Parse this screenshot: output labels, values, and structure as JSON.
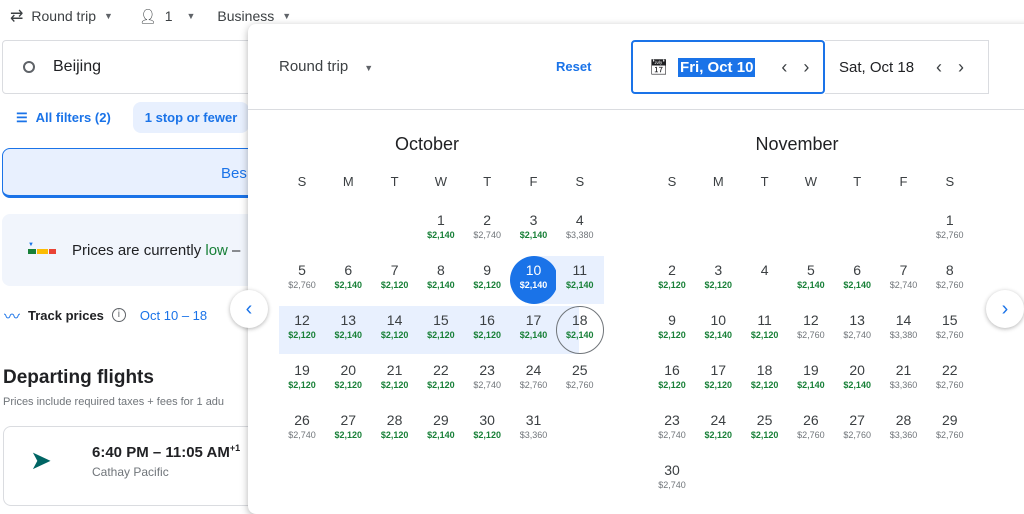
{
  "topbar": {
    "trip_type": "Round trip",
    "passengers": "1",
    "cabin": "Business"
  },
  "search": {
    "origin": "Beijing"
  },
  "filters": {
    "all_filters": "All filters (2)",
    "stops_chip": "1 stop or fewer"
  },
  "tabs": {
    "best": "Bes"
  },
  "insight": {
    "text_before": "Prices are currently ",
    "level": "low",
    "text_after": " –"
  },
  "track": {
    "label": "Track prices",
    "dates": "Oct 10 – 18"
  },
  "departing": {
    "title": "Departing flights",
    "subtitle": "Prices include required taxes + fees for 1 adu"
  },
  "flight": {
    "times": "6:40 PM – 11:05 AM",
    "plus_days": "+1",
    "airline": "Cathay Pacific"
  },
  "picker": {
    "trip_type": "Round trip",
    "reset": "Reset",
    "depart": "Fri, Oct 10",
    "return": "Sat, Oct 18"
  },
  "colors": {
    "accent": "#1a73e8",
    "low_price": "#188038",
    "normal_price": "#70757a"
  },
  "weekdays": [
    "S",
    "M",
    "T",
    "W",
    "T",
    "F",
    "S"
  ],
  "selection": {
    "start": {
      "month": 0,
      "day": 10
    },
    "end": {
      "month": 0,
      "day": 18
    }
  },
  "months": [
    {
      "name": "October",
      "offset": 3,
      "days": [
        [
          "1",
          "$2,140",
          true
        ],
        [
          "2",
          "$2,740",
          false
        ],
        [
          "3",
          "$2,140",
          true
        ],
        [
          "4",
          "$3,380",
          false
        ],
        [
          "5",
          "$2,760",
          false
        ],
        [
          "6",
          "$2,140",
          true
        ],
        [
          "7",
          "$2,120",
          true
        ],
        [
          "8",
          "$2,140",
          true
        ],
        [
          "9",
          "$2,120",
          true
        ],
        [
          "10",
          "$2,140",
          true
        ],
        [
          "11",
          "$2,140",
          true
        ],
        [
          "12",
          "$2,120",
          true
        ],
        [
          "13",
          "$2,140",
          true
        ],
        [
          "14",
          "$2,120",
          true
        ],
        [
          "15",
          "$2,120",
          true
        ],
        [
          "16",
          "$2,120",
          true
        ],
        [
          "17",
          "$2,140",
          true
        ],
        [
          "18",
          "$2,140",
          true
        ],
        [
          "19",
          "$2,120",
          true
        ],
        [
          "20",
          "$2,120",
          true
        ],
        [
          "21",
          "$2,120",
          true
        ],
        [
          "22",
          "$2,120",
          true
        ],
        [
          "23",
          "$2,740",
          false
        ],
        [
          "24",
          "$2,760",
          false
        ],
        [
          "25",
          "$2,760",
          false
        ],
        [
          "26",
          "$2,740",
          false
        ],
        [
          "27",
          "$2,120",
          true
        ],
        [
          "28",
          "$2,120",
          true
        ],
        [
          "29",
          "$2,140",
          true
        ],
        [
          "30",
          "$2,120",
          true
        ],
        [
          "31",
          "$3,360",
          false
        ]
      ]
    },
    {
      "name": "November",
      "offset": 6,
      "days": [
        [
          "1",
          "$2,760",
          false
        ],
        [
          "2",
          "$2,120",
          true
        ],
        [
          "3",
          "$2,120",
          true
        ],
        [
          "4",
          "",
          false
        ],
        [
          "5",
          "$2,140",
          true
        ],
        [
          "6",
          "$2,140",
          true
        ],
        [
          "7",
          "$2,740",
          false
        ],
        [
          "8",
          "$2,760",
          false
        ],
        [
          "9",
          "$2,120",
          true
        ],
        [
          "10",
          "$2,140",
          true
        ],
        [
          "11",
          "$2,120",
          true
        ],
        [
          "12",
          "$2,760",
          false
        ],
        [
          "13",
          "$2,740",
          false
        ],
        [
          "14",
          "$3,380",
          false
        ],
        [
          "15",
          "$2,760",
          false
        ],
        [
          "16",
          "$2,120",
          true
        ],
        [
          "17",
          "$2,120",
          true
        ],
        [
          "18",
          "$2,120",
          true
        ],
        [
          "19",
          "$2,140",
          true
        ],
        [
          "20",
          "$2,140",
          true
        ],
        [
          "21",
          "$3,360",
          false
        ],
        [
          "22",
          "$2,760",
          false
        ],
        [
          "23",
          "$2,740",
          false
        ],
        [
          "24",
          "$2,120",
          true
        ],
        [
          "25",
          "$2,120",
          true
        ],
        [
          "26",
          "$2,760",
          false
        ],
        [
          "27",
          "$2,760",
          false
        ],
        [
          "28",
          "$3,360",
          false
        ],
        [
          "29",
          "$2,760",
          false
        ],
        [
          "30",
          "$2,740",
          false
        ]
      ]
    }
  ]
}
